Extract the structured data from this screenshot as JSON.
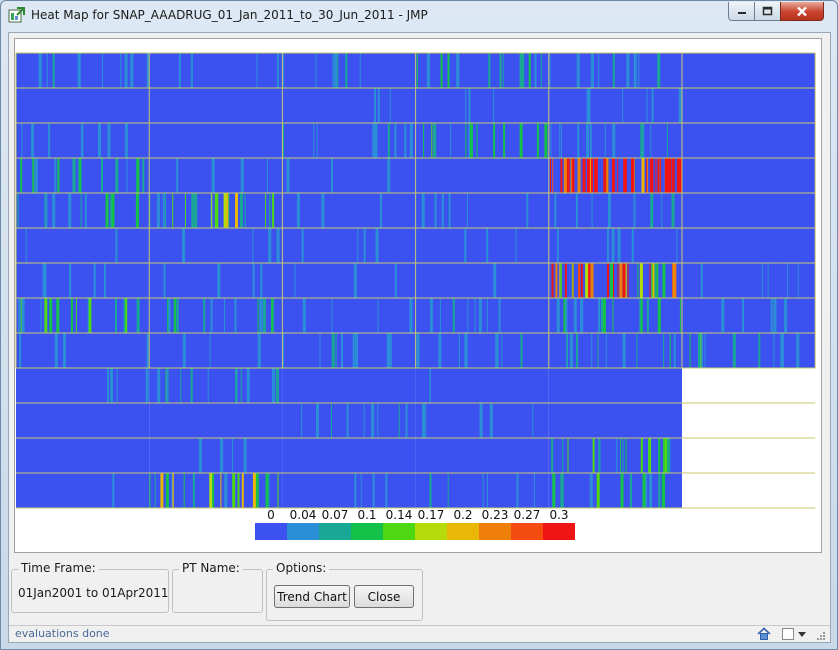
{
  "window": {
    "title": "Heat Map for SNAP_AAADRUG_01_Jan_2011_to_30_Jun_2011 - JMP",
    "icon": "jmp-app-icon"
  },
  "colors": {
    "base": "#3c52f0",
    "blank": "#ffffff",
    "divider": "#c8c86e",
    "scale": [
      "#3c52f0",
      "#2b8fd8",
      "#19a895",
      "#14c24a",
      "#4ed814",
      "#b5dc0a",
      "#e8b707",
      "#ee7f0b",
      "#f44c10",
      "#f01515"
    ]
  },
  "legend": {
    "labels": [
      "0",
      "0.04",
      "0.07",
      "0.1",
      "0.14",
      "0.17",
      "0.2",
      "0.23",
      "0.27",
      "0.3"
    ]
  },
  "chart_data": {
    "type": "heatmap",
    "rows": 13,
    "columns": 6,
    "value_range": [
      0,
      0.3
    ],
    "empty_cells": [
      [
        9,
        5
      ],
      [
        10,
        5
      ],
      [
        11,
        5
      ],
      [
        12,
        5
      ]
    ],
    "cells": [
      [
        0.02,
        0.01,
        0.02,
        0.04,
        0.02,
        0.0
      ],
      [
        0.0,
        0.0,
        0.01,
        0.01,
        0.01,
        0.0
      ],
      [
        0.02,
        0.0,
        0.02,
        0.04,
        0.03,
        0.0
      ],
      [
        0.04,
        0.01,
        0.01,
        0.0,
        0.19,
        0.0
      ],
      [
        0.04,
        0.07,
        0.01,
        0.01,
        0.02,
        0.0
      ],
      [
        0.01,
        0.01,
        0.01,
        0.01,
        0.01,
        0.0
      ],
      [
        0.01,
        0.01,
        0.01,
        0.01,
        0.13,
        0.01
      ],
      [
        0.05,
        0.04,
        0.01,
        0.02,
        0.04,
        0.01
      ],
      [
        0.01,
        0.01,
        0.02,
        0.02,
        0.03,
        0.04
      ],
      [
        0.01,
        0.03,
        0.0,
        0.01,
        0.0,
        null
      ],
      [
        0.0,
        0.01,
        0.02,
        0.01,
        0.0,
        null
      ],
      [
        0.0,
        0.01,
        0.0,
        0.0,
        0.05,
        null
      ],
      [
        0.01,
        0.07,
        0.01,
        0.02,
        0.04,
        null
      ]
    ]
  },
  "controls": {
    "time_frame": {
      "label": "Time Frame:",
      "value": "01Jan2001 to 01Apr2011"
    },
    "pt_name": {
      "label": "PT Name:"
    },
    "options": {
      "label": "Options:",
      "trend_chart": "Trend Chart",
      "close": "Close"
    }
  },
  "status": {
    "text": "evaluations done"
  }
}
